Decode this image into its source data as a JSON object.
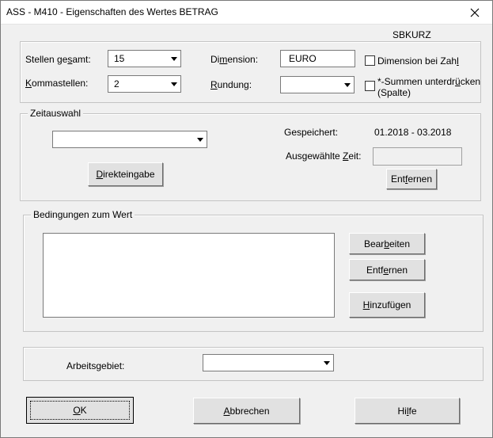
{
  "window": {
    "title": "ASS - M410 - Eigenschaften des Wertes BETRAG"
  },
  "header": {
    "sbkurz": "SBKURZ"
  },
  "props": {
    "stellen_label_pre": "Stellen ge",
    "stellen_label_u": "s",
    "stellen_label_post": "amt:",
    "stellen_value": "15",
    "komma_label_pre": "",
    "komma_label_u": "K",
    "komma_label_post": "ommastellen:",
    "komma_value": "2",
    "dimension_label_pre": "Di",
    "dimension_label_u": "m",
    "dimension_label_post": "ension:",
    "dimension_value": "EURO",
    "rundung_label_pre": "",
    "rundung_label_u": "R",
    "rundung_label_post": "undung:",
    "rundung_value": "",
    "dim_bei_zahl_pre": "Dimension bei Zah",
    "dim_bei_zahl_u": "l",
    "dim_bei_zahl_post": "",
    "summen_line1_pre": "*-Summen unterdr",
    "summen_line1_u": "ü",
    "summen_line1_post": "cken",
    "summen_line2": "(Spalte)"
  },
  "zeitauswahl": {
    "legend": "Zeitauswahl",
    "combo_value": "",
    "direkt_pre": "",
    "direkt_u": "D",
    "direkt_post": "irekteingabe",
    "gespeichert_label": "Gespeichert:",
    "gespeichert_value": "01.2018 - 03.2018",
    "ausgewaehlt_pre": "Ausgewählte ",
    "ausgewaehlt_u": "Z",
    "ausgewaehlt_post": "eit:",
    "ausgewaehlt_value": "",
    "entfernen_pre": "Ent",
    "entfernen_u": "f",
    "entfernen_post": "ernen"
  },
  "bedingungen": {
    "legend": "Bedingungen zum Wert",
    "bearbeiten_pre": "Bear",
    "bearbeiten_u": "b",
    "bearbeiten_post": "eiten",
    "entfernen_pre": "Entf",
    "entfernen_u": "e",
    "entfernen_post": "rnen",
    "hinzu_pre": "",
    "hinzu_u": "H",
    "hinzu_post": "inzufügen"
  },
  "arbeitsgebiet": {
    "label": "Arbeitsgebiet:",
    "value": ""
  },
  "footer": {
    "ok_pre": "",
    "ok_u": "O",
    "ok_post": "K",
    "abbrechen_pre": "",
    "abbrechen_u": "A",
    "abbrechen_post": "bbrechen",
    "hilfe_pre": "Hi",
    "hilfe_u": "l",
    "hilfe_post": "fe"
  },
  "colors": {
    "dialog_bg": "#f0f0f0",
    "button_bg": "#e1e1e1"
  }
}
